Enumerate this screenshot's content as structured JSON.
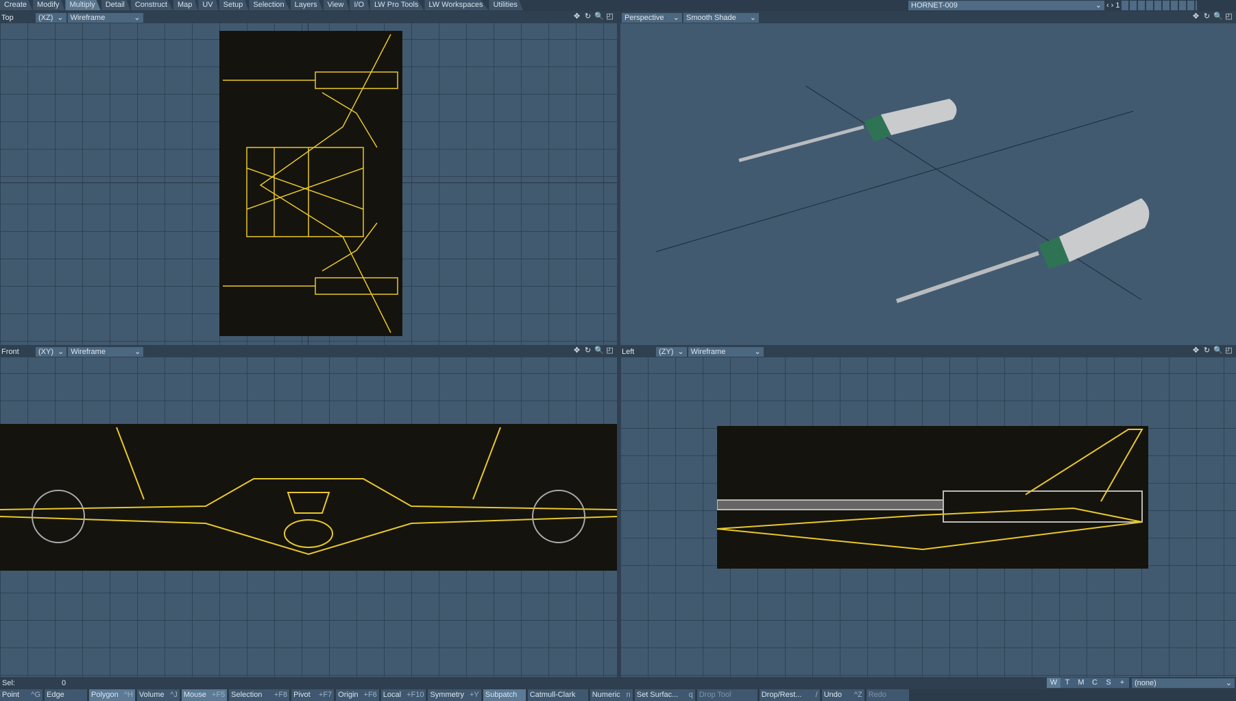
{
  "menu": {
    "tabs": [
      "Create",
      "Modify",
      "Multiply",
      "Detail",
      "Construct",
      "Map",
      "UV",
      "Setup",
      "Selection",
      "Layers",
      "View",
      "I/O",
      "LW Pro Tools",
      "LW Workspaces",
      "Utilities"
    ],
    "active": "Multiply"
  },
  "object": {
    "name": "HORNET-009",
    "layer": "1"
  },
  "viewports": [
    {
      "view": "Top",
      "axes": "(XZ)",
      "mode": "Wireframe"
    },
    {
      "view": "Perspective",
      "mode": "Smooth Shade"
    },
    {
      "view": "Front",
      "axes": "(XY)",
      "mode": "Wireframe"
    },
    {
      "view": "Left",
      "axes": "(ZY)",
      "mode": "Wireframe"
    }
  ],
  "status": {
    "sel_label": "Sel:",
    "sel_value": "0",
    "wtmcs": [
      "W",
      "T",
      "M",
      "C",
      "S",
      "+"
    ],
    "surface": "(none)"
  },
  "bottom": [
    {
      "label": "Point",
      "key": "^G"
    },
    {
      "label": "Edge",
      "key": ""
    },
    {
      "label": "Polygon",
      "key": "^H",
      "on": true
    },
    {
      "label": "Volume",
      "key": "^J"
    },
    {
      "label": "Mouse",
      "key": "+F5",
      "on": true
    },
    {
      "label": "Selection",
      "key": "+F8"
    },
    {
      "label": "Pivot",
      "key": "+F7"
    },
    {
      "label": "Origin",
      "key": "+F6"
    },
    {
      "label": "Local",
      "key": "+F10"
    },
    {
      "label": "Symmetry",
      "key": "+Y"
    },
    {
      "label": "Subpatch",
      "key": "",
      "on": true
    },
    {
      "label": "Catmull-Clark",
      "key": ""
    },
    {
      "label": "Numeric",
      "key": "n"
    },
    {
      "label": "Set Surfac...",
      "key": "q"
    },
    {
      "label": "Drop Tool",
      "key": ""
    },
    {
      "label": "Drop/Rest...",
      "key": "/"
    },
    {
      "label": "Undo",
      "key": "^Z"
    },
    {
      "label": "Redo",
      "key": ""
    }
  ]
}
